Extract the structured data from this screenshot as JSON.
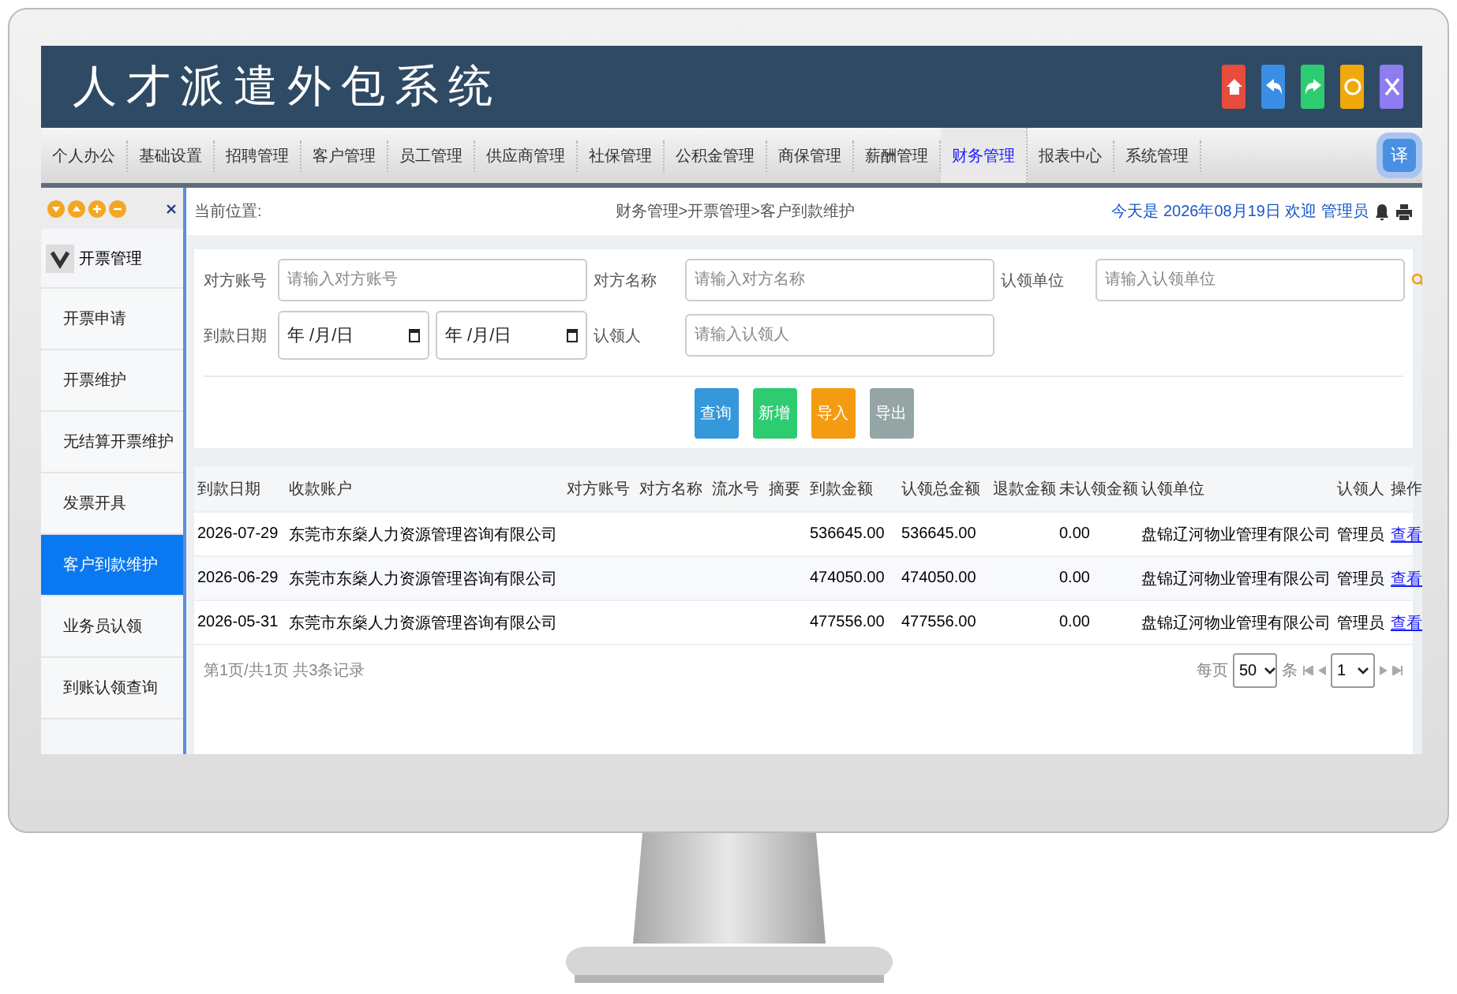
{
  "header": {
    "title": "人才派遣外包系统"
  },
  "nav": {
    "tabs": [
      {
        "label": "个人办公",
        "selected": false
      },
      {
        "label": "基础设置",
        "selected": false
      },
      {
        "label": "招聘管理",
        "selected": false
      },
      {
        "label": "客户管理",
        "selected": false
      },
      {
        "label": "员工管理",
        "selected": false
      },
      {
        "label": "供应商管理",
        "selected": false
      },
      {
        "label": "社保管理",
        "selected": false
      },
      {
        "label": "公积金管理",
        "selected": false
      },
      {
        "label": "商保管理",
        "selected": false
      },
      {
        "label": "薪酬管理",
        "selected": false
      },
      {
        "label": "财务管理",
        "selected": true
      },
      {
        "label": "报表中心",
        "selected": false
      },
      {
        "label": "系统管理",
        "selected": false
      }
    ],
    "translate": "译"
  },
  "sidebar": {
    "group": {
      "label": "开票管理",
      "expanded": true
    },
    "items": [
      {
        "label": "开票申请",
        "selected": false
      },
      {
        "label": "开票维护",
        "selected": false
      },
      {
        "label": "无结算开票维护",
        "selected": false
      },
      {
        "label": "发票开具",
        "selected": false
      },
      {
        "label": "客户到款维护",
        "selected": true
      },
      {
        "label": "业务员认领",
        "selected": false
      },
      {
        "label": "到账认领查询",
        "selected": false
      }
    ]
  },
  "breadcrumb": {
    "label": "当前位置:",
    "path": "财务管理>开票管理>客户到款维护",
    "greeting": "今天是 2026年08月19日 欢迎 管理员"
  },
  "filters": [
    {
      "label": "对方账号",
      "placeholder": "请输入对方账号"
    },
    {
      "label": "对方名称",
      "placeholder": "请输入对方名称"
    },
    {
      "label": "认领单位",
      "placeholder": "请输入认领单位"
    },
    {
      "label": "到款日期",
      "date_from": "年 /月/日",
      "date_to": "年 /月/日"
    },
    {
      "label": "认领人",
      "placeholder": "请输入认领人"
    }
  ],
  "buttons": [
    {
      "label": "查询",
      "color": "#3498db"
    },
    {
      "label": "新增",
      "color": "#2ecc71"
    },
    {
      "label": "导入",
      "color": "#f39c12"
    },
    {
      "label": "导出",
      "color": "#95a5a6"
    }
  ],
  "table": {
    "columns": [
      "到款日期",
      "收款账户",
      "对方账号",
      "对方名称",
      "流水号",
      "摘要",
      "到款金额",
      "认领总金额",
      "退款金额",
      "未认领金额",
      "认领单位",
      "认领人",
      "操作"
    ],
    "rows": [
      [
        "2026-07-29",
        "东莞市东燊人力资源管理咨询有限公司",
        "",
        "",
        "",
        "",
        "536645.00",
        "536645.00",
        "",
        "0.00",
        "盘锦辽河物业管理有限公司",
        "管理员",
        "查看"
      ],
      [
        "2026-06-29",
        "东莞市东燊人力资源管理咨询有限公司",
        "",
        "",
        "",
        "",
        "474050.00",
        "474050.00",
        "",
        "0.00",
        "盘锦辽河物业管理有限公司",
        "管理员",
        "查看"
      ],
      [
        "2026-05-31",
        "东莞市东燊人力资源管理咨询有限公司",
        "",
        "",
        "",
        "",
        "477556.00",
        "477556.00",
        "",
        "0.00",
        "盘锦辽河物业管理有限公司",
        "管理员",
        "查看"
      ]
    ]
  },
  "pager": {
    "summary": "第1页/共1页 共3条记录",
    "per_page_label": "每页",
    "per_page": "50",
    "unit": "条",
    "page": "1"
  }
}
